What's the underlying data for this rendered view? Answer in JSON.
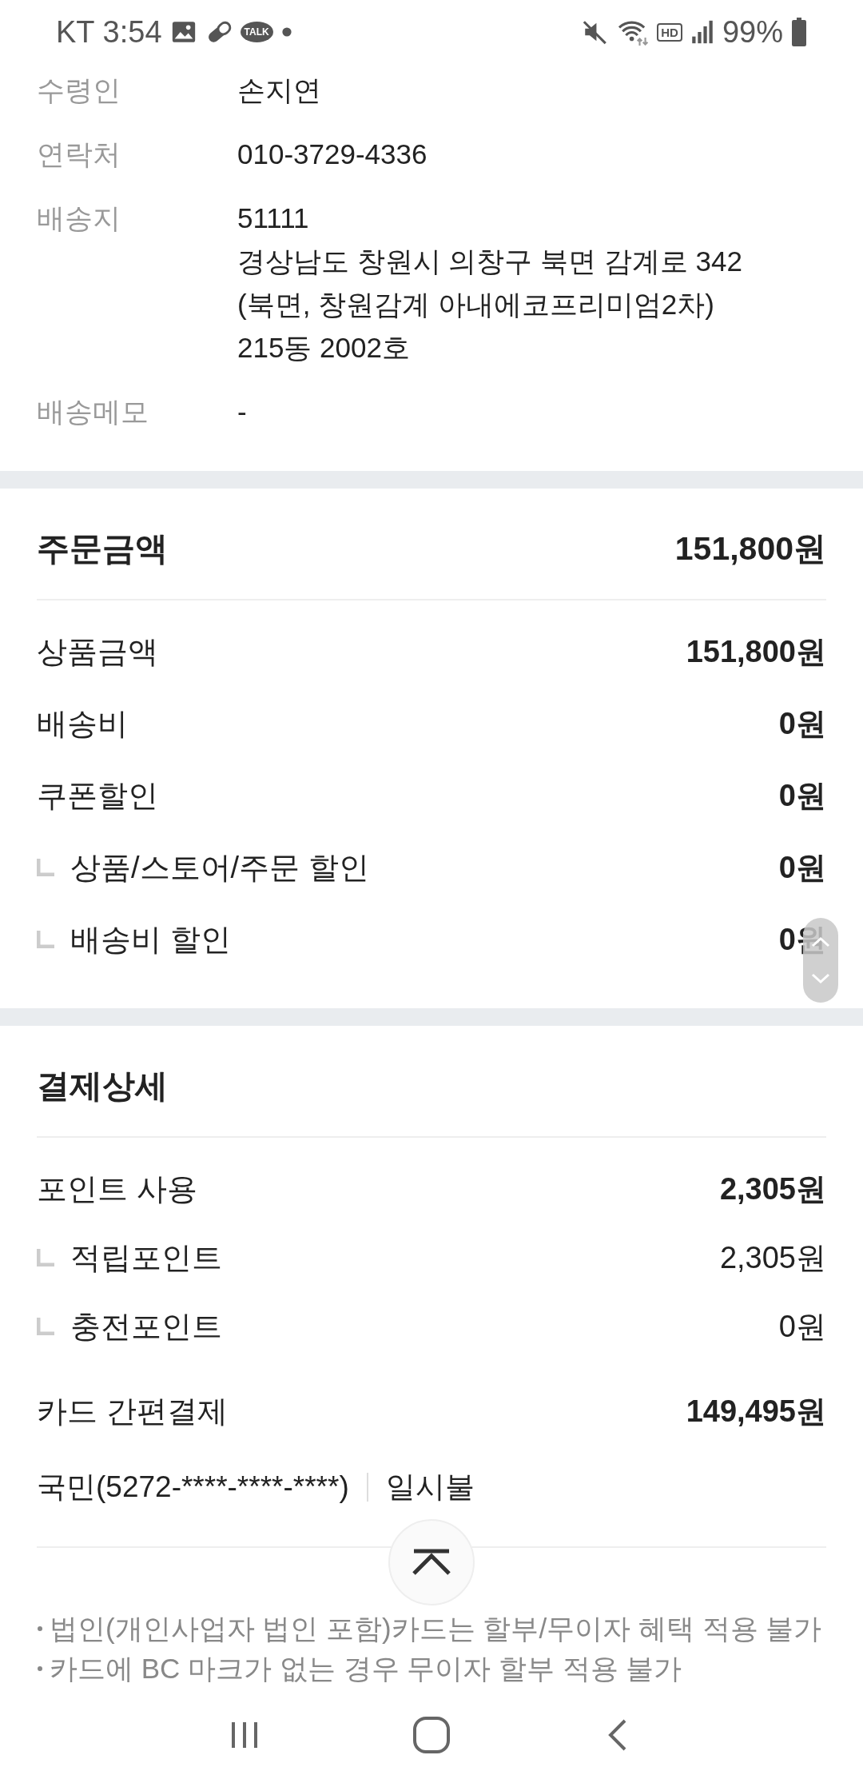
{
  "status_bar": {
    "carrier": "KT",
    "time": "3:54",
    "talk_badge": "TALK",
    "hd_badge": "HD",
    "battery": "99%"
  },
  "delivery": {
    "rows": [
      {
        "label": "수령인",
        "lines": [
          "손지연"
        ]
      },
      {
        "label": "연락처",
        "lines": [
          "010-3729-4336"
        ]
      },
      {
        "label": "배송지",
        "lines": [
          "51111",
          "경상남도 창원시 의창구 북면 감계로 342",
          "(북면, 창원감계 아내에코프리미엄2차)",
          "215동 2002호"
        ]
      },
      {
        "label": "배송메모",
        "lines": [
          "-"
        ]
      }
    ]
  },
  "order_amount": {
    "title": "주문금액",
    "total": "151,800원",
    "rows": [
      {
        "kind": "main",
        "label": "상품금액",
        "value": "151,800원",
        "emphasis": true
      },
      {
        "kind": "main",
        "label": "배송비",
        "value": "0원",
        "emphasis": true
      },
      {
        "kind": "main",
        "label": "쿠폰할인",
        "value": "0원",
        "emphasis": true
      },
      {
        "kind": "sub",
        "label": "상품/스토어/주문 할인",
        "value": "0원",
        "emphasis": true
      },
      {
        "kind": "sub",
        "label": "배송비 할인",
        "value": "0원",
        "emphasis": true
      }
    ]
  },
  "payment_detail": {
    "title": "결제상세",
    "rows": [
      {
        "kind": "main",
        "label": "포인트 사용",
        "value": "2,305원",
        "emphasis": true
      },
      {
        "kind": "sub",
        "label": "적립포인트",
        "value": "2,305원",
        "emphasis": false
      },
      {
        "kind": "sub",
        "label": "충전포인트",
        "value": "0원",
        "emphasis": false
      },
      {
        "kind": "main",
        "label": "카드 간편결제",
        "value": "149,495원",
        "emphasis": true
      }
    ],
    "card": {
      "name": "국민(5272-****-****-****)",
      "installment": "일시불"
    },
    "notes": [
      "법인(개인사업자 법인 포함)카드는 할부/무이자 혜택 적용 불가",
      "카드에 BC 마크가 없는 경우 무이자 할부 적용 불가"
    ]
  }
}
